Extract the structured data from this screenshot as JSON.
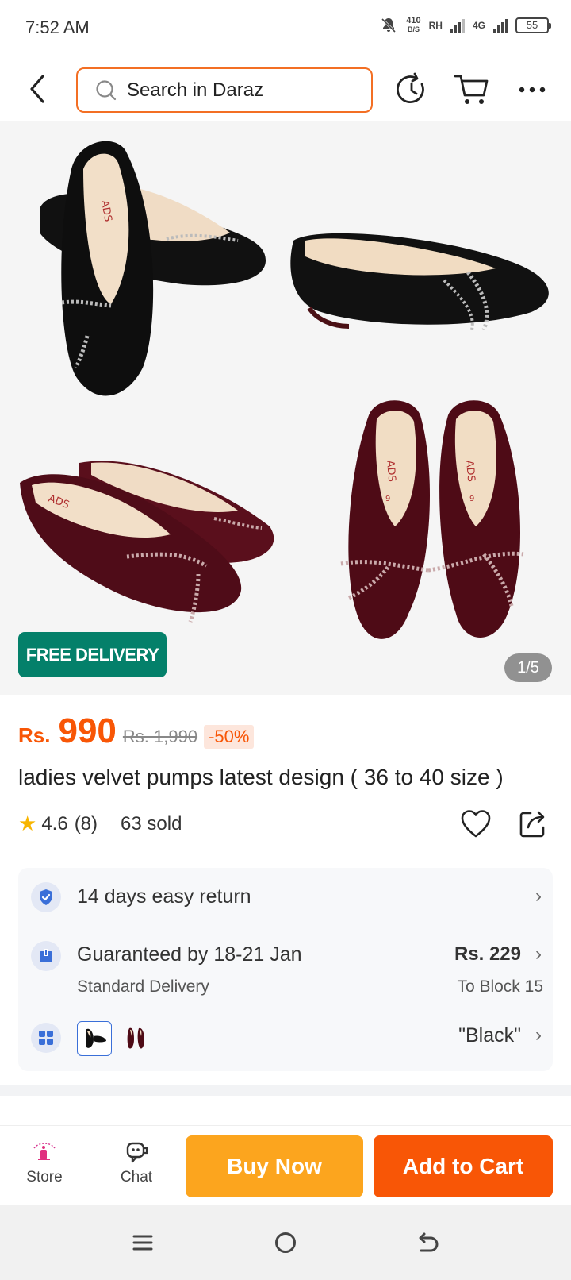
{
  "status_bar": {
    "time": "7:52 AM",
    "net_speed_value": "410",
    "net_speed_unit": "B/S",
    "carrier": "RH",
    "network": "4G",
    "battery": "55"
  },
  "header": {
    "search_placeholder": "Search in Daraz"
  },
  "gallery": {
    "badge": "FREE DELIVERY",
    "counter": "1/5",
    "shoe_brand": "ADS",
    "shoe_size": "9"
  },
  "product": {
    "currency": "Rs.",
    "price": "990",
    "old_price": "Rs. 1,990",
    "discount": "-50%",
    "title": "ladies velvet pumps latest design ( 36 to 40 size )",
    "rating": "4.6",
    "rating_count": "(8)",
    "sold": "63 sold"
  },
  "info": {
    "return_text": "14 days easy return",
    "delivery_text": "Guaranteed by 18-21 Jan",
    "delivery_sub": "Standard Delivery",
    "delivery_price": "Rs. 229",
    "delivery_location": "To Block 15",
    "variant_selected": "\"Black\""
  },
  "actions": {
    "store_label": "Store",
    "chat_label": "Chat",
    "buy_now": "Buy Now",
    "add_to_cart": "Add to Cart"
  },
  "colors": {
    "brand_orange": "#f85606",
    "buy_now": "#fca51e",
    "free_delivery": "#04806a"
  }
}
